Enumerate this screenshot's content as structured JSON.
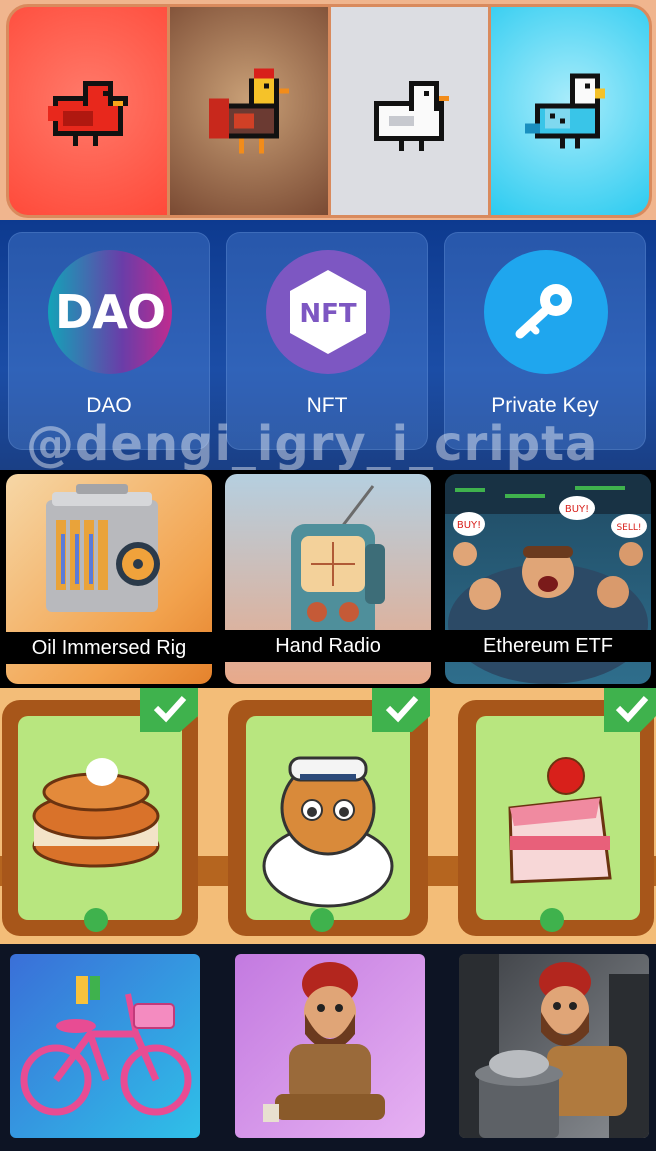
{
  "birds": [
    {
      "name": "red-bird",
      "bg": "#ff5a4c"
    },
    {
      "name": "rooster",
      "bg": "#8a5a3e"
    },
    {
      "name": "white-bird",
      "bg": "#dcdde2"
    },
    {
      "name": "blue-parakeet",
      "bg": "#3fd3f5"
    }
  ],
  "cards": {
    "dao": {
      "label": "DAO",
      "icon_text": "DAO"
    },
    "nft": {
      "label": "NFT",
      "icon_text": "NFT"
    },
    "private_key": {
      "label": "Private Key"
    }
  },
  "watermark": "@dengi_igry_i_cripta",
  "items": {
    "oil": {
      "caption": "Oil Immersed Rig"
    },
    "radio": {
      "caption": "Hand Radio"
    },
    "etf": {
      "caption": "Ethereum ETF",
      "signs": [
        "BUY!",
        "BUY!",
        "SELL!"
      ]
    }
  },
  "cafe": [
    {
      "name": "pancakes",
      "checked": true
    },
    {
      "name": "captain-cat",
      "checked": true
    },
    {
      "name": "strawberry-cake",
      "checked": true
    }
  ],
  "bottom": [
    {
      "name": "pink-bicycle"
    },
    {
      "name": "homeless-man-sitting"
    },
    {
      "name": "homeless-man-trash"
    }
  ],
  "colors": {
    "nft_purple": "#7d57c2",
    "key_blue": "#1fa6ee",
    "dao_grad_start": "#13a3b8",
    "dao_grad_end": "#c02b8f",
    "check_green": "#3fb24d"
  }
}
